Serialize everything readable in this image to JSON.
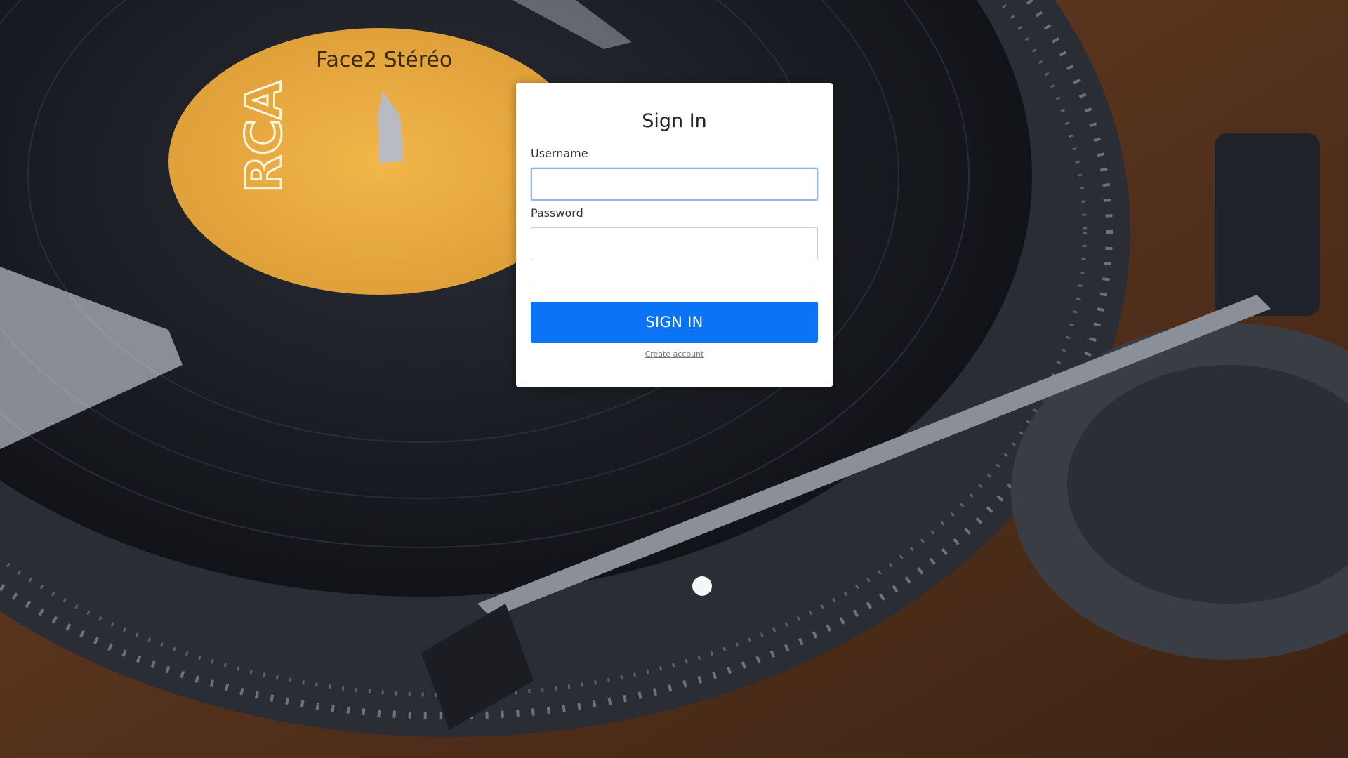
{
  "background": {
    "record_label_text": "Face2 Stéréo"
  },
  "login": {
    "title": "Sign In",
    "username_label": "Username",
    "username_value": "",
    "password_label": "Password",
    "password_value": "",
    "submit_label": "SIGN IN",
    "create_account_label": "Create account"
  },
  "colors": {
    "primary_button": "#0a74f5",
    "card_background": "#ffffff"
  }
}
